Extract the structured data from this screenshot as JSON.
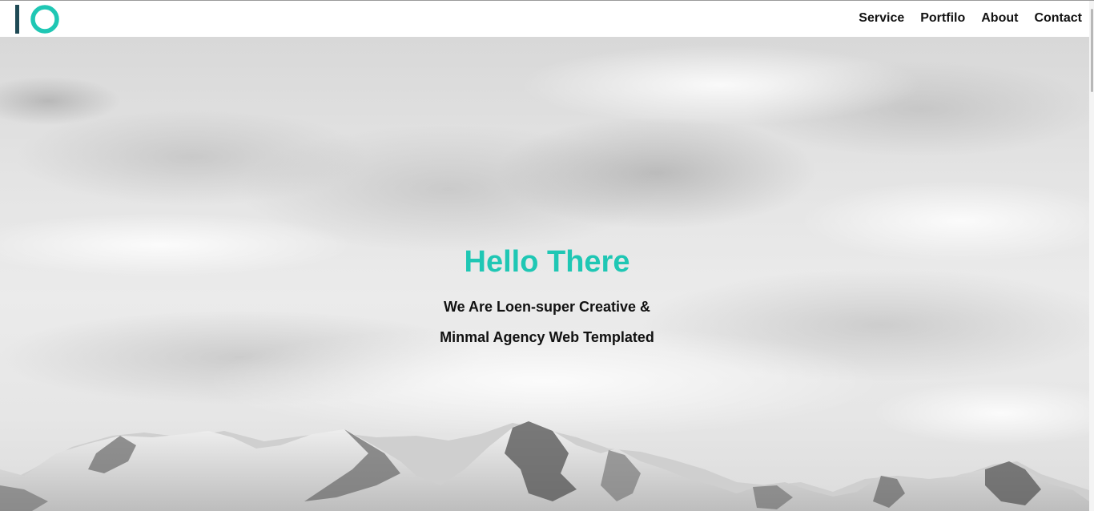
{
  "header": {
    "logo_name": "IO logo"
  },
  "nav": {
    "items": [
      {
        "label": "Service"
      },
      {
        "label": "Portfilo"
      },
      {
        "label": "About"
      },
      {
        "label": "Contact"
      }
    ]
  },
  "hero": {
    "title": "Hello There",
    "subtitle_line1": "We Are Loen-super Creative &",
    "subtitle_line2": "Minmal Agency Web Templated",
    "background": "grayscale mountain peaks under cloudy sky"
  },
  "colors": {
    "accent": "#1fc7b4",
    "logo_dark": "#1f4a55",
    "text": "#111111",
    "nav_background": "#ffffff"
  },
  "icons": [
    "logo-icon"
  ]
}
